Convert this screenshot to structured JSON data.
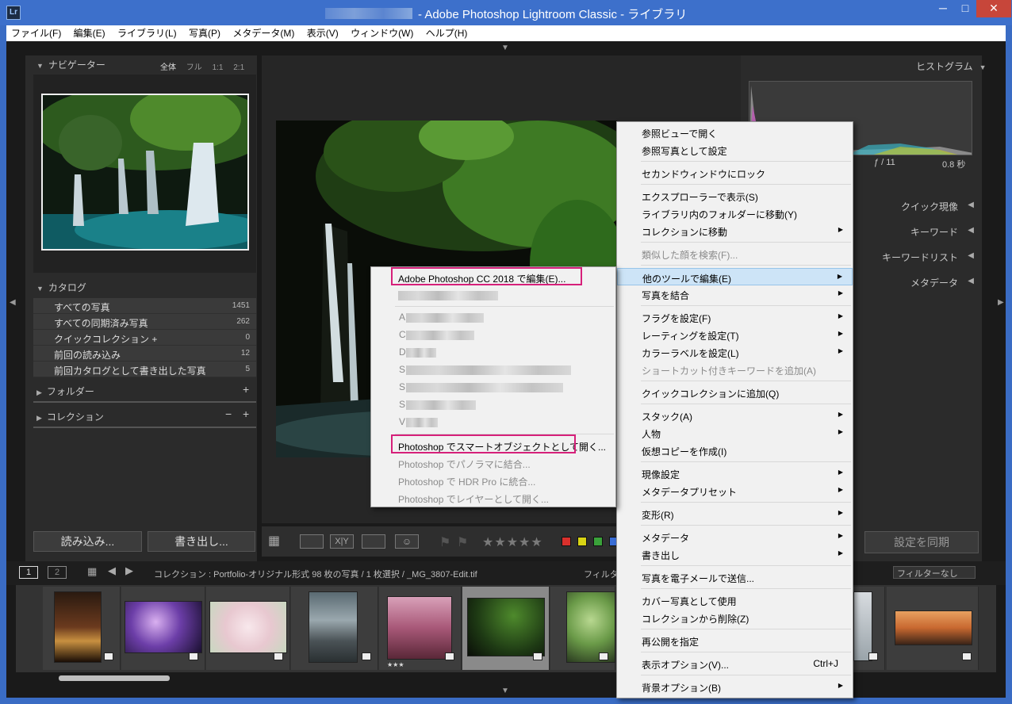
{
  "window": {
    "title": "- Adobe Photoshop Lightroom Classic - ライブラリ",
    "app_icon": "Lr",
    "minimize": "─",
    "maximize": "□",
    "close": "✕"
  },
  "menubar": [
    "ファイル(F)",
    "編集(E)",
    "ライブラリ(L)",
    "写真(P)",
    "メタデータ(M)",
    "表示(V)",
    "ウィンドウ(W)",
    "ヘルプ(H)"
  ],
  "left_panel": {
    "navigator": {
      "title": "ナビゲーター",
      "options": [
        "全体",
        "フル",
        "1:1",
        "2:1"
      ]
    },
    "catalog": {
      "title": "カタログ",
      "items": [
        {
          "label": "すべての写真",
          "count": "1451"
        },
        {
          "label": "すべての同期済み写真",
          "count": "262"
        },
        {
          "label": "クイックコレクション +",
          "count": "0"
        },
        {
          "label": "前回の読み込み",
          "count": "12"
        },
        {
          "label": "前回カタログとして書き出した写真",
          "count": "5"
        }
      ]
    },
    "folders": "フォルダー",
    "collections": "コレクション",
    "import_btn": "読み込み...",
    "export_btn": "書き出し..."
  },
  "right_panel": {
    "histogram": "ヒストグラム",
    "aperture": "ƒ / 11",
    "shutter": "0.8 秒",
    "sections": [
      "クイック現像",
      "キーワード",
      "キーワードリスト",
      "メタデータ"
    ],
    "sync_btn": "設定を同期"
  },
  "filmstrip_bar": {
    "pages": [
      "1",
      "2"
    ],
    "path": "コレクション : Portfolio-オリジナル形式  98 枚の写真 / 1 枚選択 / _MG_3807-Edit.tif",
    "filter_label": "フィルター :",
    "filter_value": "フィルターなし"
  },
  "toolbar": {
    "stars": "★★★★★",
    "colors": [
      "#d9302c",
      "#d8d414",
      "#3aa23a",
      "#3a6fd8"
    ]
  },
  "filmstrip": {
    "rating_label": "★★★"
  },
  "context_menu": {
    "items": [
      {
        "label": "参照ビューで開く"
      },
      {
        "label": "参照写真として設定",
        "sep_after": true
      },
      {
        "label": "セカンドウィンドウにロック",
        "sep_after": true
      },
      {
        "label": "エクスプローラーで表示(S)"
      },
      {
        "label": "ライブラリ内のフォルダーに移動(Y)"
      },
      {
        "label": "コレクションに移動",
        "submenu": true,
        "sep_after": true
      },
      {
        "label": "類似した顔を検索(F)...",
        "disabled": true,
        "sep_after": true
      },
      {
        "label": "他のツールで編集(E)",
        "submenu": true,
        "highlight": true
      },
      {
        "label": "写真を結合",
        "submenu": true,
        "sep_after": true
      },
      {
        "label": "フラグを設定(F)",
        "submenu": true
      },
      {
        "label": "レーティングを設定(T)",
        "submenu": true
      },
      {
        "label": "カラーラベルを設定(L)",
        "submenu": true
      },
      {
        "label": "ショートカット付きキーワードを追加(A)",
        "disabled": true,
        "sep_after": true
      },
      {
        "label": "クイックコレクションに追加(Q)",
        "sep_after": true
      },
      {
        "label": "スタック(A)",
        "submenu": true
      },
      {
        "label": "人物",
        "submenu": true
      },
      {
        "label": "仮想コピーを作成(I)",
        "sep_after": true
      },
      {
        "label": "現像設定",
        "submenu": true
      },
      {
        "label": "メタデータプリセット",
        "submenu": true,
        "sep_after": true
      },
      {
        "label": "変形(R)",
        "submenu": true,
        "sep_after": true
      },
      {
        "label": "メタデータ",
        "submenu": true
      },
      {
        "label": "書き出し",
        "submenu": true,
        "sep_after": true
      },
      {
        "label": "写真を電子メールで送信...",
        "sep_after": true
      },
      {
        "label": "カバー写真として使用"
      },
      {
        "label": "コレクションから削除(Z)",
        "sep_after": true
      },
      {
        "label": "再公開を指定",
        "sep_after": true
      },
      {
        "label": "表示オプション(V)...",
        "shortcut": "Ctrl+J",
        "sep_after": true
      },
      {
        "label": "背景オプション(B)",
        "submenu": true
      }
    ]
  },
  "submenu": {
    "top": "Adobe Photoshop CC 2018 で編集(E)...",
    "blurred_initials": [
      "A",
      "C",
      "D",
      "S",
      "S",
      "S",
      "V"
    ],
    "smart_object": "Photoshop でスマートオブジェクトとして開く...",
    "panorama": "Photoshop でパノラマに結合...",
    "hdr": "Photoshop で HDR Pro に統合...",
    "layers": "Photoshop でレイヤーとして開く..."
  }
}
